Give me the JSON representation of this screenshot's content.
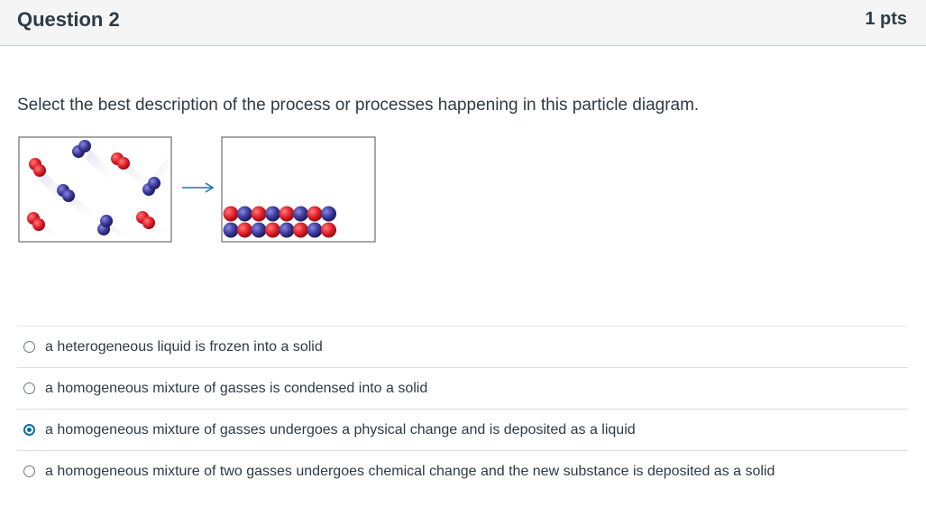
{
  "question": {
    "title": "Question 2",
    "points": "1 pts",
    "text": "Select the best description of the process or processes happening in this particle diagram."
  },
  "answers": [
    {
      "label": "a heterogeneous liquid is frozen into a solid",
      "selected": false
    },
    {
      "label": "a homogeneous mixture of gasses is condensed into a solid",
      "selected": false
    },
    {
      "label": "a homogeneous mixture of gasses undergoes a physical change and is deposited as a liquid",
      "selected": true
    },
    {
      "label": "a homogeneous mixture of two gasses undergoes chemical change and the new substance is deposited as a solid",
      "selected": false
    }
  ],
  "colors": {
    "red_molecule": "#e0202a",
    "blue_molecule": "#3c3a9c",
    "arrow": "#1a73b5",
    "selected_radio": "#0770a3"
  }
}
